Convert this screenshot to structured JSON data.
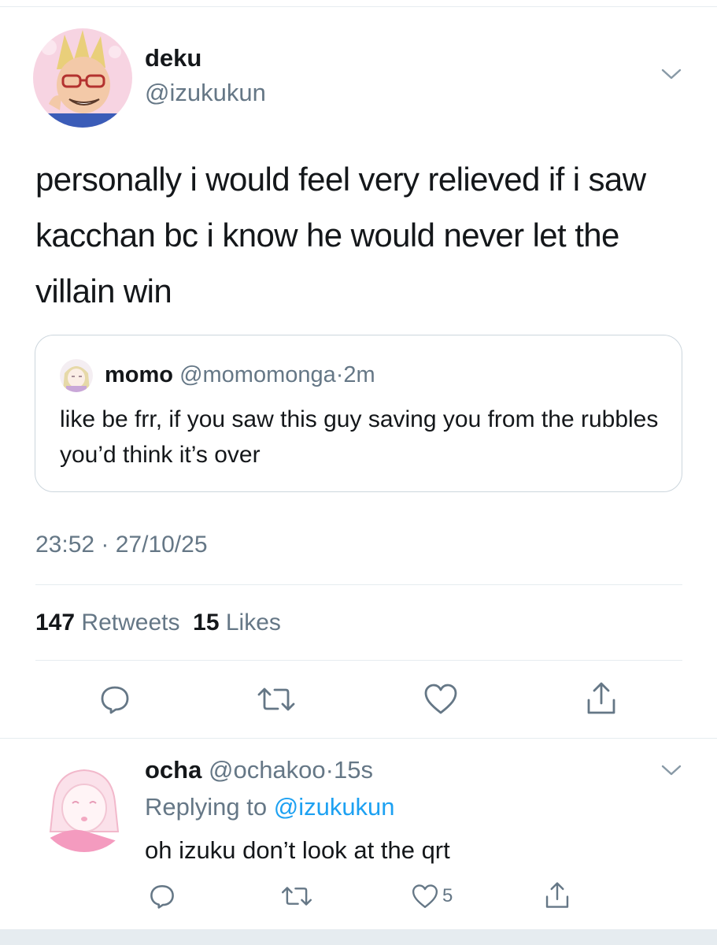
{
  "tweet": {
    "author_name": "deku",
    "author_handle": "@izukukun",
    "text": "personally i would feel very relieved if i saw kacchan bc i know he would never let the villain win",
    "quoted": {
      "name": "momo",
      "handle": "@momomonga",
      "separator": "·",
      "time": "2m",
      "text": "like be frr, if you saw this guy saving you from the rubbles you’d think it’s over"
    },
    "timestamp": "23:52 · 27/10/25",
    "retweets_count": "147",
    "retweets_label": "Retweets",
    "likes_count": "15",
    "likes_label": "Likes",
    "actions": [
      "reply-icon",
      "retweet-icon",
      "like-icon",
      "share-icon"
    ]
  },
  "reply": {
    "name": "ocha",
    "handle": "@ochakoo",
    "separator": "·",
    "time": "15s",
    "replying_label": "Replying to",
    "replying_handle": "@izukukun",
    "text": "oh izuku don’t look at the qrt",
    "like_count": "5",
    "actions": [
      "reply-icon",
      "retweet-icon",
      "like-icon",
      "share-icon"
    ]
  },
  "colors": {
    "text": "#14171a",
    "secondary": "#657786",
    "link": "#1da1f2",
    "border": "#e6ecf0"
  }
}
